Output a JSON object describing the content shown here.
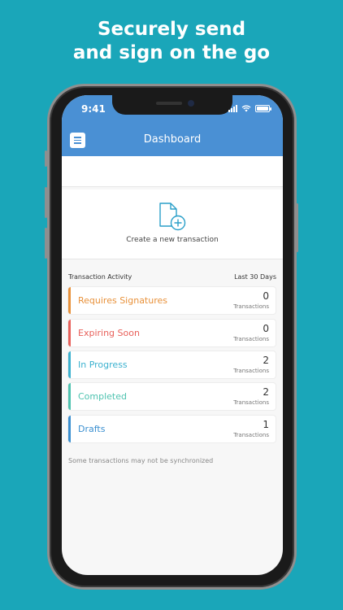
{
  "headline": {
    "line1": "Securely send",
    "line2": "and sign on the go"
  },
  "status_bar": {
    "time": "9:41",
    "icons": [
      "signal-icon",
      "wifi-icon",
      "battery-icon"
    ]
  },
  "app_bar": {
    "title": "Dashboard",
    "menu_icon": "menu-icon",
    "color": "#4a90d4"
  },
  "create": {
    "label": "Create a new transaction",
    "icon": "new-document-icon",
    "color": "#2a9fc9"
  },
  "activity": {
    "title": "Transaction Activity",
    "range": "Last 30 Days",
    "rows": [
      {
        "label": "Requires Signatures",
        "count": "0",
        "unit": "Transactions",
        "color": "#e8913a"
      },
      {
        "label": "Expiring Soon",
        "count": "0",
        "unit": "Transactions",
        "color": "#e8605a"
      },
      {
        "label": "In Progress",
        "count": "2",
        "unit": "Transactions",
        "color": "#3bb1cf"
      },
      {
        "label": "Completed",
        "count": "2",
        "unit": "Transactions",
        "color": "#4fc3b0"
      },
      {
        "label": "Drafts",
        "count": "1",
        "unit": "Transactions",
        "color": "#3a8fd0"
      }
    ],
    "note": "Some transactions may not be synchronized"
  },
  "colors": {
    "background": "#1aa6b9"
  }
}
